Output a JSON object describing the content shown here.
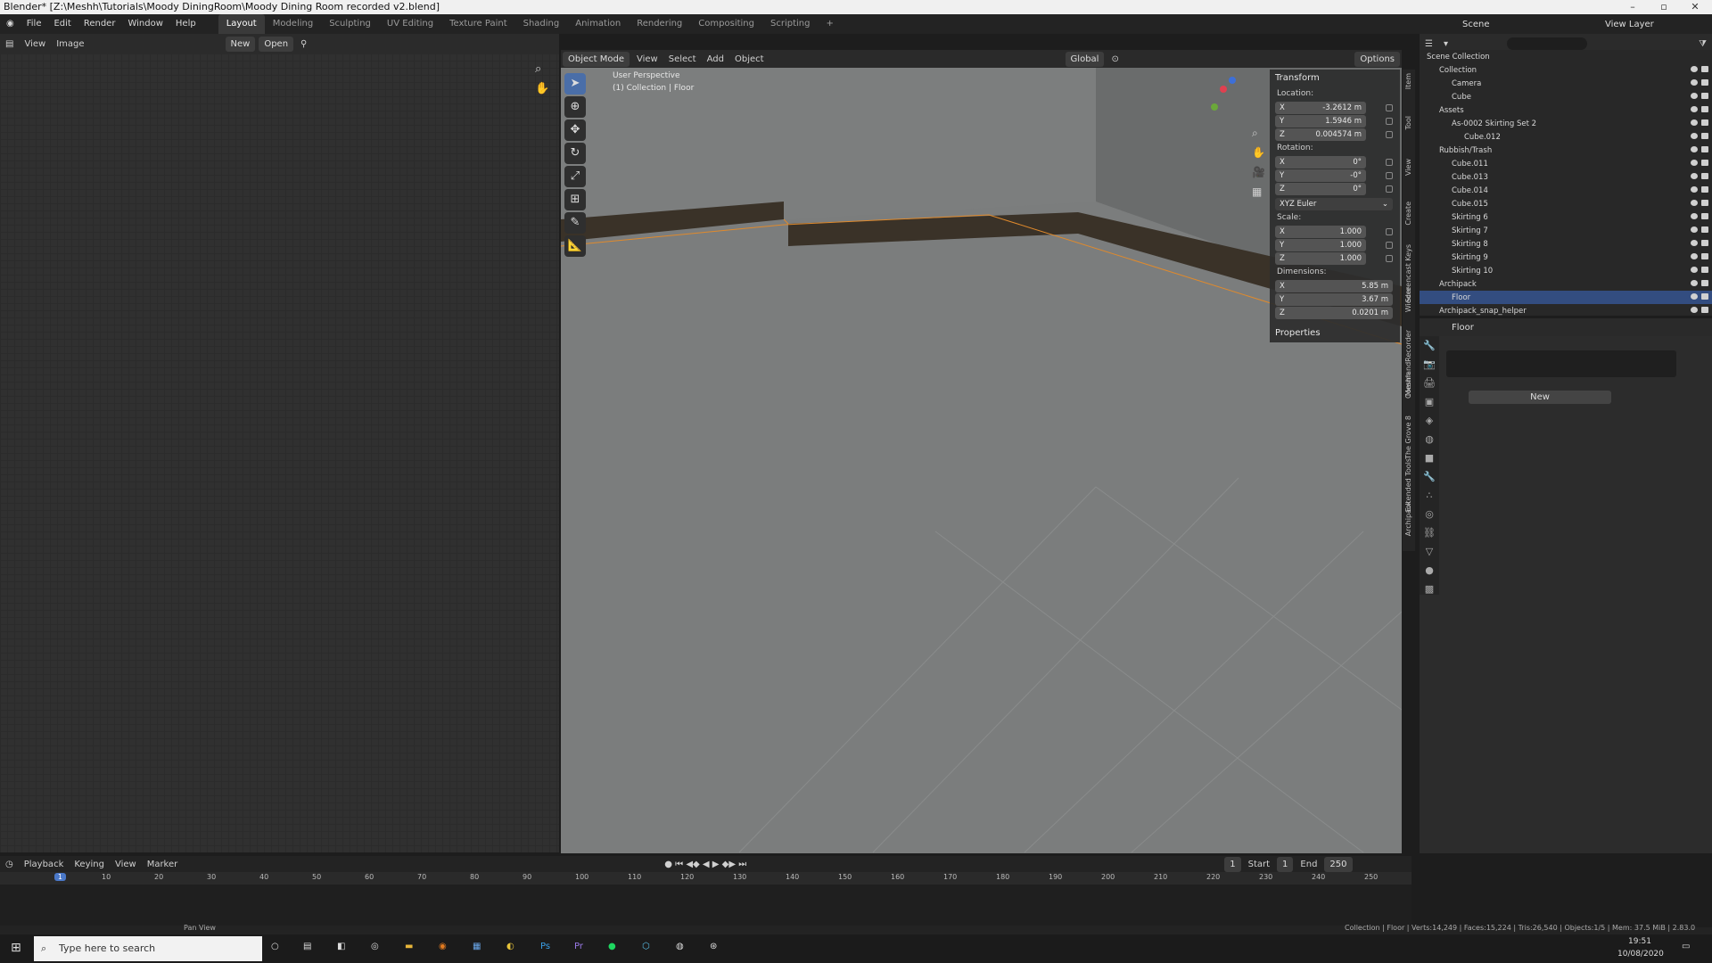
{
  "window": {
    "title": "Blender* [Z:\\Meshh\\Tutorials\\Moody DiningRoom\\Moody Dining Room recorded v2.blend]"
  },
  "menu": [
    "File",
    "Edit",
    "Render",
    "Window",
    "Help"
  ],
  "workspaces": [
    "Layout",
    "Modeling",
    "Sculpting",
    "UV Editing",
    "Texture Paint",
    "Shading",
    "Animation",
    "Rendering",
    "Compositing",
    "Scripting"
  ],
  "topright": {
    "scene": "Scene",
    "view_layer": "View Layer"
  },
  "image_editor": {
    "view": "View",
    "image": "Image",
    "new": "New",
    "open": "Open"
  },
  "viewport": {
    "mode": "Object Mode",
    "view": "View",
    "select": "Select",
    "add": "Add",
    "object": "Object",
    "orientation": "Global",
    "options": "Options",
    "perspective": "User Perspective",
    "collection_label": "(1) Collection | Floor"
  },
  "npanel": {
    "transform": "Transform",
    "location": "Location:",
    "loc": {
      "x": "-3.2612 m",
      "y": "1.5946 m",
      "z": "0.004574 m"
    },
    "rotation": "Rotation:",
    "rot": {
      "x": "0°",
      "y": "-0°",
      "z": "0°"
    },
    "euler": "XYZ Euler",
    "scale": "Scale:",
    "scl": {
      "x": "1.000",
      "y": "1.000",
      "z": "1.000"
    },
    "dimensions": "Dimensions:",
    "dim": {
      "x": "5.85 m",
      "y": "3.67 m",
      "z": "0.0201 m"
    },
    "properties": "Properties"
  },
  "side_tabs": [
    "Item",
    "Tool",
    "View",
    "Create",
    "Screencast Keys",
    "Wieder",
    "CommandRecorder",
    "Meshh",
    "The Grove 8",
    "Extended Tools",
    "Archipack"
  ],
  "outliner": {
    "rows": [
      {
        "label": "Scene Collection",
        "indent": 0
      },
      {
        "label": "Collection",
        "indent": 1
      },
      {
        "label": "Camera",
        "indent": 2
      },
      {
        "label": "Cube",
        "indent": 2
      },
      {
        "label": "Assets",
        "indent": 1
      },
      {
        "label": "As-0002 Skirting Set 2",
        "indent": 2
      },
      {
        "label": "Cube.012",
        "indent": 3
      },
      {
        "label": "Rubbish/Trash",
        "indent": 1
      },
      {
        "label": "Cube.011",
        "indent": 2
      },
      {
        "label": "Cube.013",
        "indent": 2
      },
      {
        "label": "Cube.014",
        "indent": 2
      },
      {
        "label": "Cube.015",
        "indent": 2
      },
      {
        "label": "Skirting 6",
        "indent": 2
      },
      {
        "label": "Skirting 7",
        "indent": 2
      },
      {
        "label": "Skirting 8",
        "indent": 2
      },
      {
        "label": "Skirting 9",
        "indent": 2
      },
      {
        "label": "Skirting 10",
        "indent": 2
      },
      {
        "label": "Archipack",
        "indent": 1
      },
      {
        "label": "Floor",
        "indent": 2
      },
      {
        "label": "Archipack_snap_helper",
        "indent": 1
      }
    ]
  },
  "props": {
    "object": "Floor",
    "new": "New"
  },
  "timeline": {
    "playback": "Playback",
    "keying": "Keying",
    "view": "View",
    "marker": "Marker",
    "current": "1",
    "start_label": "Start",
    "start": "1",
    "end_label": "End",
    "end": "250",
    "ticks": [
      "1",
      "10",
      "20",
      "30",
      "40",
      "50",
      "60",
      "70",
      "80",
      "90",
      "100",
      "110",
      "120",
      "130",
      "140",
      "150",
      "160",
      "170",
      "180",
      "190",
      "200",
      "210",
      "220",
      "230",
      "240",
      "250"
    ]
  },
  "status": {
    "pan": "Pan View",
    "info": "Collection | Floor | Verts:14,249 | Faces:15,224 | Tris:26,540 | Objects:1/5 | Mem: 37.5 MiB | 2.83.0"
  },
  "taskbar": {
    "search": "Type here to search",
    "time": "19:51",
    "date": "10/08/2020"
  }
}
